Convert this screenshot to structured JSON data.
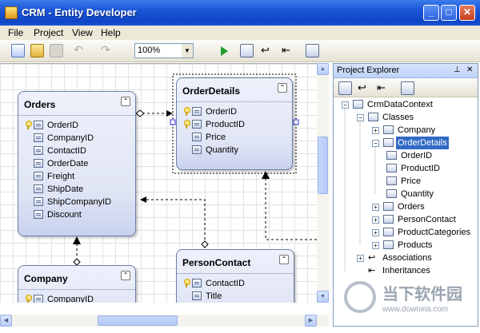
{
  "window": {
    "title": "CRM - Entity Developer",
    "minimize": "_",
    "maximize": "□",
    "close": "✕"
  },
  "menu": {
    "file": "File",
    "project": "Project",
    "view": "View",
    "help": "Help"
  },
  "toolbar": {
    "zoom": "100%"
  },
  "entities": {
    "orders": {
      "title": "Orders",
      "props": [
        "OrderID",
        "CompanyID",
        "ContactID",
        "OrderDate",
        "Freight",
        "ShipDate",
        "ShipCompanyID",
        "Discount"
      ]
    },
    "order_details": {
      "title": "OrderDetails",
      "props": [
        "OrderID",
        "ProductID",
        "Price",
        "Quantity"
      ]
    },
    "company": {
      "title": "Company",
      "props": [
        "CompanyID"
      ]
    },
    "person_contact": {
      "title": "PersonContact",
      "props": [
        "ContactID",
        "Title"
      ]
    }
  },
  "explorer": {
    "title": "Project Explorer",
    "tree": {
      "root": "CrmDataContext",
      "classes": "Classes",
      "company": "Company",
      "order_details": "OrderDetails",
      "od_orderid": "OrderID",
      "od_productid": "ProductID",
      "od_price": "Price",
      "od_quantity": "Quantity",
      "orders": "Orders",
      "person_contact": "PersonContact",
      "product_categories": "ProductCategories",
      "products": "Products",
      "associations": "Associations",
      "inheritances": "Inheritances"
    }
  },
  "watermark": {
    "line1": "当下软件园",
    "line2": "www.downxia.com"
  },
  "colors": {
    "title_bar": "#1b56d6",
    "selection": "#316ac5",
    "entity_border": "#6b7fa8"
  }
}
